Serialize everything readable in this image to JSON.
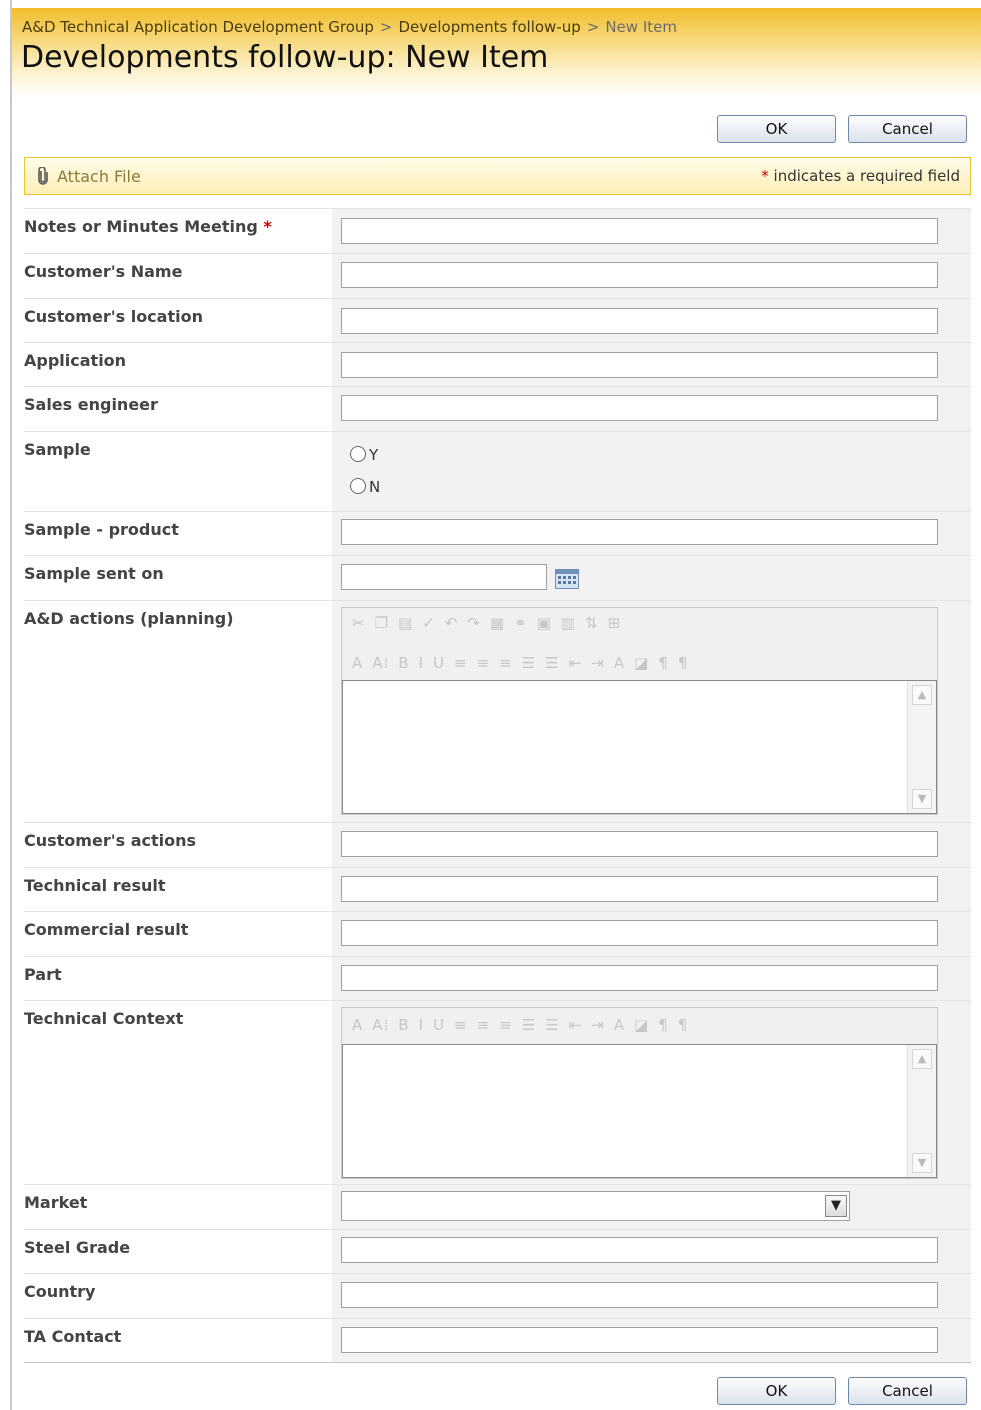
{
  "breadcrumb": {
    "items": [
      "A&D Technical Application Development Group",
      "Developments follow-up"
    ],
    "separator": ">",
    "current": "New Item"
  },
  "page_title": "Developments follow-up: New Item",
  "buttons": {
    "ok": "OK",
    "cancel": "Cancel"
  },
  "toolbar": {
    "attach_label": "Attach File",
    "required_star": "*",
    "required_note": "indicates a required field"
  },
  "fields": {
    "notes": {
      "label": "Notes or Minutes Meeting",
      "required_star": "*",
      "value": ""
    },
    "customer_name": {
      "label": "Customer's Name",
      "value": ""
    },
    "customer_location": {
      "label": "Customer's location",
      "value": ""
    },
    "application": {
      "label": "Application",
      "value": ""
    },
    "sales_engineer": {
      "label": "Sales engineer",
      "value": ""
    },
    "sample": {
      "label": "Sample",
      "options": [
        "Y",
        "N"
      ],
      "selected": ""
    },
    "sample_product": {
      "label": "Sample - product",
      "value": ""
    },
    "sample_sent_on": {
      "label": "Sample sent on",
      "value": ""
    },
    "ad_actions": {
      "label": "A&D actions (planning)",
      "value": ""
    },
    "customer_actions": {
      "label": "Customer's actions",
      "value": ""
    },
    "technical_result": {
      "label": "Technical result",
      "value": ""
    },
    "commercial_result": {
      "label": "Commercial result",
      "value": ""
    },
    "part": {
      "label": "Part",
      "value": ""
    },
    "technical_context": {
      "label": "Technical Context",
      "value": ""
    },
    "market": {
      "label": "Market",
      "selected": ""
    },
    "steel_grade": {
      "label": "Steel Grade",
      "value": ""
    },
    "country": {
      "label": "Country",
      "value": ""
    },
    "ta_contact": {
      "label": "TA Contact",
      "value": ""
    }
  },
  "colors": {
    "header_gold": "#f1bd2c",
    "toolbar_border": "#f0c43a",
    "required_red": "#d40000",
    "field_bg": "#f2f2f2"
  },
  "icons": [
    "paperclip-icon",
    "calendar-icon",
    "scroll-up-icon",
    "scroll-down-icon",
    "dropdown-arrow-icon"
  ]
}
